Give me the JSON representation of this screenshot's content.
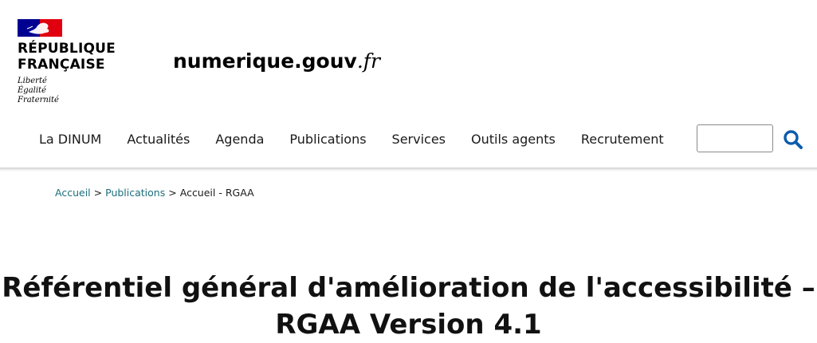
{
  "header": {
    "logo": {
      "title_line1": "RÉPUBLIQUE",
      "title_line2": "FRANÇAISE",
      "motto": [
        "Liberté",
        "Égalité",
        "Fraternité"
      ],
      "colors": {
        "blue": "#000091",
        "red": "#e1000f"
      }
    },
    "site_name": "numerique.gouv",
    "site_tld": ".fr"
  },
  "nav": {
    "items": [
      {
        "label": "La DINUM"
      },
      {
        "label": "Actualités"
      },
      {
        "label": "Agenda"
      },
      {
        "label": "Publications"
      },
      {
        "label": "Services"
      },
      {
        "label": "Outils agents"
      },
      {
        "label": "Recrutement"
      }
    ],
    "search": {
      "value": "",
      "icon": "search-icon",
      "icon_color": "#0b5cad"
    }
  },
  "breadcrumb": {
    "items": [
      {
        "label": "Accueil"
      },
      {
        "label": "Publications"
      }
    ],
    "current": "Accueil - RGAA",
    "separator": ">"
  },
  "main": {
    "title_line1": "Référentiel général d'amélioration de l'accessibilité –",
    "title_line2": "RGAA Version 4.1"
  }
}
